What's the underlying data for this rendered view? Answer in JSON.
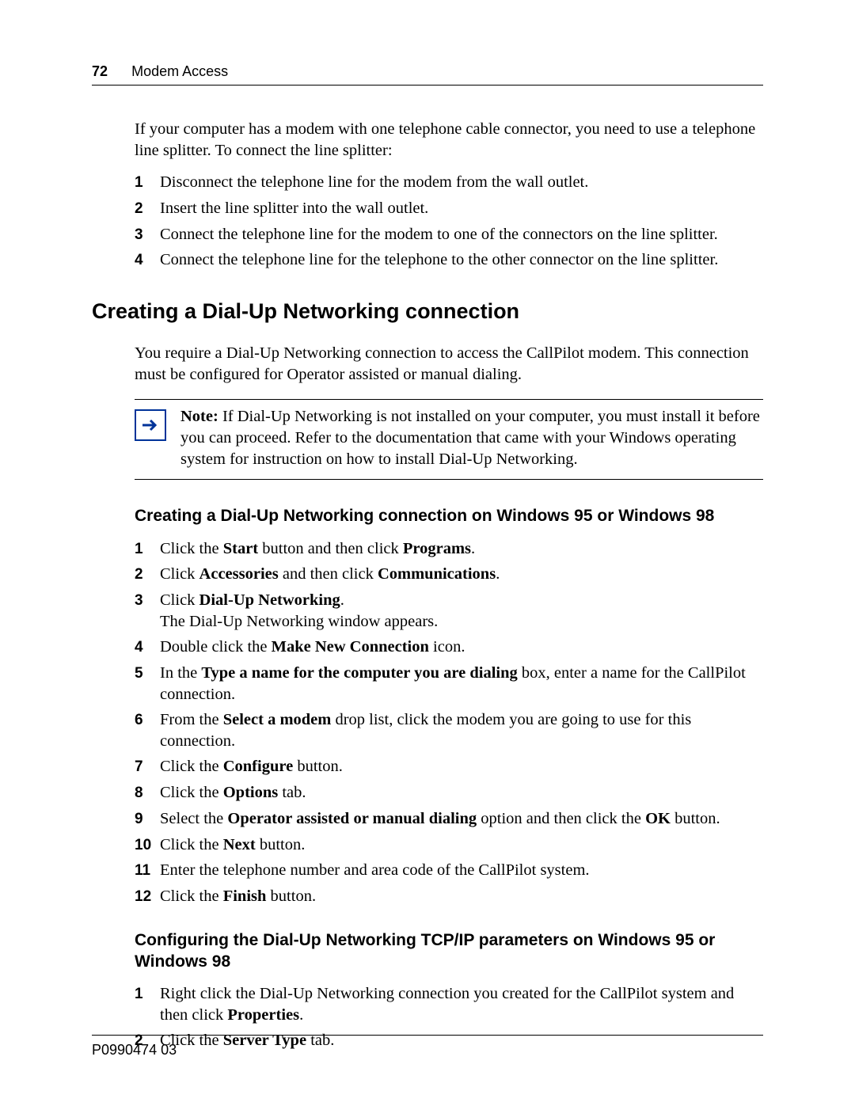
{
  "header": {
    "page_number": "72",
    "section_title": "Modem Access"
  },
  "intro": "If your computer has a modem with one telephone cable connector, you need to use a telephone line splitter. To connect the line splitter:",
  "splitter_steps": [
    "Disconnect the telephone line for the modem from the wall outlet.",
    "Insert the line splitter into the wall outlet.",
    "Connect the telephone line for the modem to one of the connectors on the line splitter.",
    "Connect the telephone line for the telephone to the other connector on the line splitter."
  ],
  "h2": "Creating a Dial-Up Networking connection",
  "dialup_intro": "You require a Dial-Up Networking connection to access the CallPilot modem. This connection must be configured for Operator assisted or manual dialing.",
  "note": {
    "label": "Note:",
    "body": " If Dial-Up Networking is not installed on your computer, you must install it before you can proceed. Refer to the documentation that came with your Windows operating system for instruction on how to install Dial-Up Networking."
  },
  "sub1_heading": "Creating a Dial-Up Networking connection on Windows 95 or Windows 98",
  "steps1": {
    "s1": {
      "a": "Click the ",
      "b": "Start",
      "c": " button and then click ",
      "d": "Programs",
      "e": "."
    },
    "s2": {
      "a": "Click ",
      "b": "Accessories",
      "c": " and then click ",
      "d": "Communications",
      "e": "."
    },
    "s3": {
      "a": "Click ",
      "b": "Dial-Up Networking",
      "c": ".",
      "line2": "The Dial-Up Networking window appears."
    },
    "s4": {
      "a": "Double click the ",
      "b": "Make New Connection",
      "c": " icon."
    },
    "s5": {
      "a": "In the ",
      "b": "Type a name for the computer you are dialing",
      "c": " box, enter a name for the CallPilot connection."
    },
    "s6": {
      "a": "From the ",
      "b": "Select a modem",
      "c": " drop list, click the modem you are going to use for this connection."
    },
    "s7": {
      "a": "Click the ",
      "b": "Configure",
      "c": " button."
    },
    "s8": {
      "a": "Click the ",
      "b": "Options",
      "c": " tab."
    },
    "s9": {
      "a": "Select the ",
      "b": "Operator assisted or manual dialing",
      "c": " option and then click the ",
      "d": "OK",
      "e": " button."
    },
    "s10": {
      "a": "Click the ",
      "b": "Next",
      "c": " button."
    },
    "s11": {
      "a": "Enter the telephone number and area code of the CallPilot system."
    },
    "s12": {
      "a": "Click the ",
      "b": "Finish",
      "c": " button."
    }
  },
  "sub2_heading": "Configuring the Dial-Up Networking TCP/IP parameters on Windows 95 or Windows 98",
  "steps2": {
    "s1": {
      "a": "Right click the Dial-Up Networking connection you created for the CallPilot system and then click ",
      "b": "Properties",
      "c": "."
    },
    "s2": {
      "a": "Click the ",
      "b": "Server Type",
      "c": " tab."
    }
  },
  "footer": "P0990474 03",
  "nums": {
    "n1": "1",
    "n2": "2",
    "n3": "3",
    "n4": "4",
    "n5": "5",
    "n6": "6",
    "n7": "7",
    "n8": "8",
    "n9": "9",
    "n10": "10",
    "n11": "11",
    "n12": "12"
  }
}
